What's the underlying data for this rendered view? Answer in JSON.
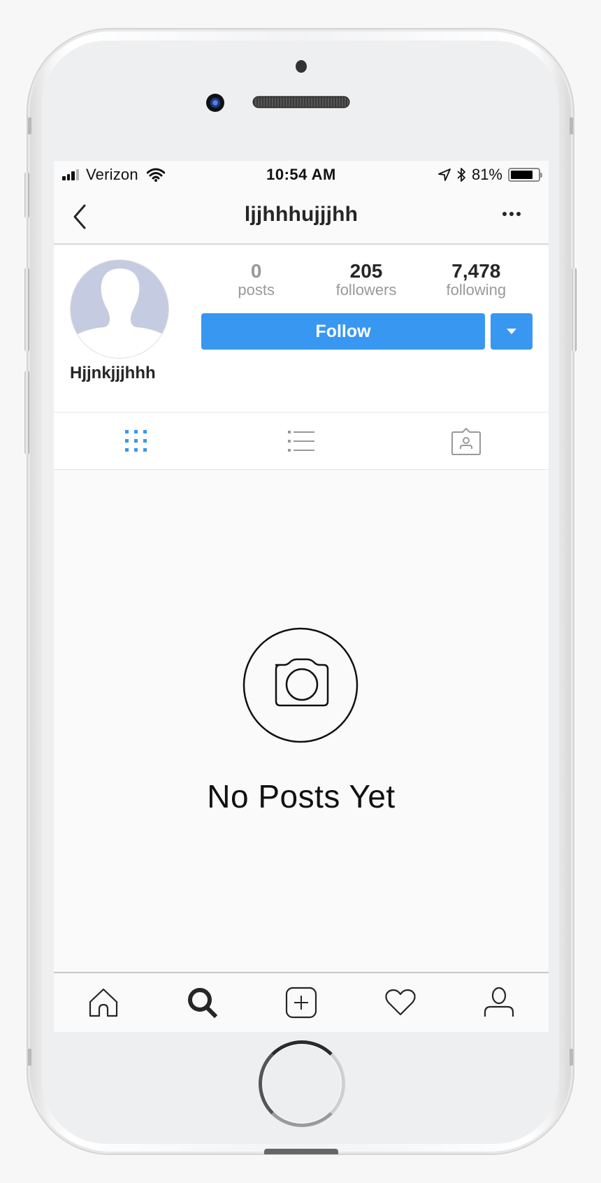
{
  "status_bar": {
    "carrier": "Verizon",
    "time": "10:54 AM",
    "battery_percent_label": "81%",
    "battery_level": 0.81,
    "signal_bars_filled": 3,
    "signal_bars_total": 4,
    "icons": [
      "signal-icon",
      "wifi-icon",
      "location-arrow-icon",
      "bluetooth-icon",
      "battery-icon"
    ]
  },
  "header": {
    "title": "ljjhhhujjjhh",
    "back_icon": "chevron-left-icon",
    "more_icon": "more-horizontal-icon"
  },
  "profile": {
    "display_name": "Hjjnkjjjhhh",
    "avatar_icon": "default-avatar-silhouette",
    "stats": [
      {
        "value": "0",
        "label": "posts"
      },
      {
        "value": "205",
        "label": "followers"
      },
      {
        "value": "7,478",
        "label": "following"
      }
    ],
    "follow_label": "Follow",
    "dropdown_icon": "caret-down-icon"
  },
  "tabs": [
    {
      "name": "grid",
      "icon": "grid-icon",
      "active": true
    },
    {
      "name": "list",
      "icon": "list-icon",
      "active": false
    },
    {
      "name": "tagged",
      "icon": "tagged-photos-icon",
      "active": false
    }
  ],
  "empty_state": {
    "icon": "camera-icon",
    "text": "No Posts Yet"
  },
  "tab_bar": [
    {
      "name": "home",
      "icon": "home-icon",
      "active": false
    },
    {
      "name": "search",
      "icon": "search-icon",
      "active": true
    },
    {
      "name": "new-post",
      "icon": "plus-square-icon",
      "active": false
    },
    {
      "name": "activity",
      "icon": "heart-icon",
      "active": false
    },
    {
      "name": "profile",
      "icon": "user-icon",
      "active": false
    }
  ],
  "colors": {
    "accent": "#3897f0",
    "text_primary": "#262626",
    "text_muted": "#999999",
    "avatar_silhouette": "#c5cbe0"
  }
}
